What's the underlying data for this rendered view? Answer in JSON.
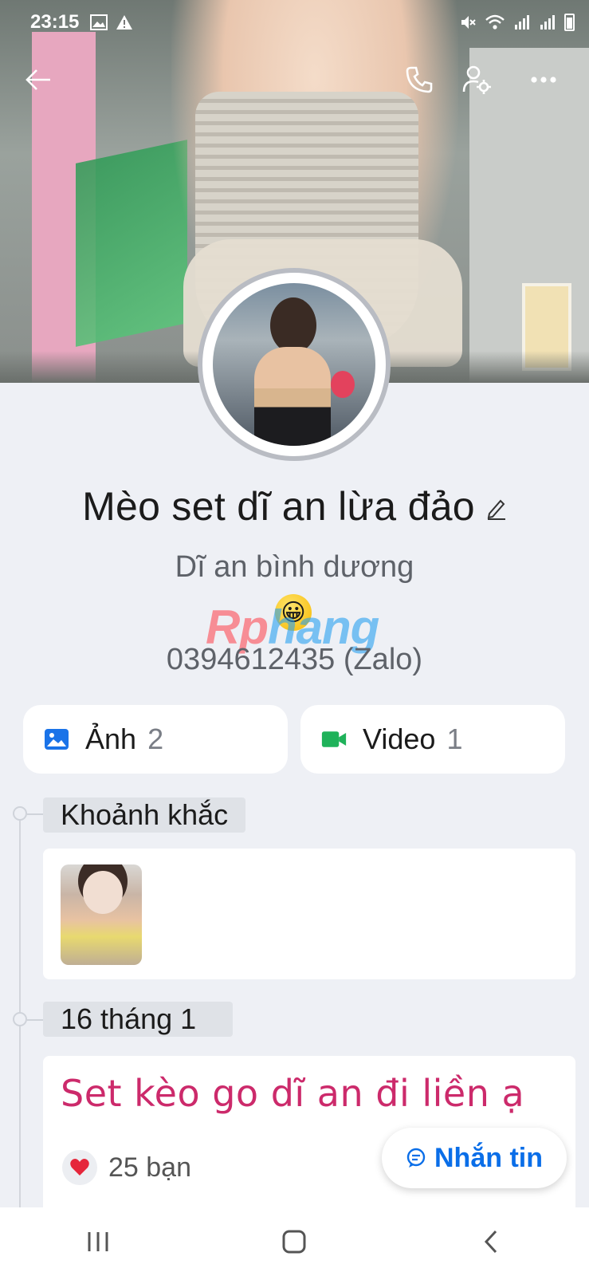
{
  "status_bar": {
    "time": "23:15"
  },
  "profile": {
    "name": "Mèo set dĩ an lừa đảo",
    "bio_line_1": "Dĩ an bình dương",
    "bio_line_2": "0394612435 (Zalo)",
    "emoji": "😀"
  },
  "watermark": {
    "text_1": "Rp",
    "text_2": "hang"
  },
  "media": {
    "photos_label": "Ảnh",
    "photos_count": "2",
    "videos_label": "Video",
    "videos_count": "1"
  },
  "timeline": {
    "moments_label": "Khoảnh khắc",
    "date_label": "16 tháng 1",
    "post_text": "Set kèo go dĩ an đi liền ạ",
    "reaction_count": "25 bạn"
  },
  "fab": {
    "label": "Nhắn tin"
  },
  "icons": {
    "back": "back-arrow-icon",
    "call": "phone-icon",
    "settings": "person-settings-icon",
    "more": "more-dots-icon",
    "edit": "pencil-icon",
    "photos": "image-icon",
    "videos": "video-camera-icon",
    "heart": "heart-icon",
    "message": "chat-bubble-icon"
  },
  "colors": {
    "accent_blue": "#0a6ee8",
    "post_text": "#cc2a6b",
    "video_green": "#1fb25a",
    "photo_blue": "#1a73e8",
    "heart_red": "#e5263b"
  }
}
